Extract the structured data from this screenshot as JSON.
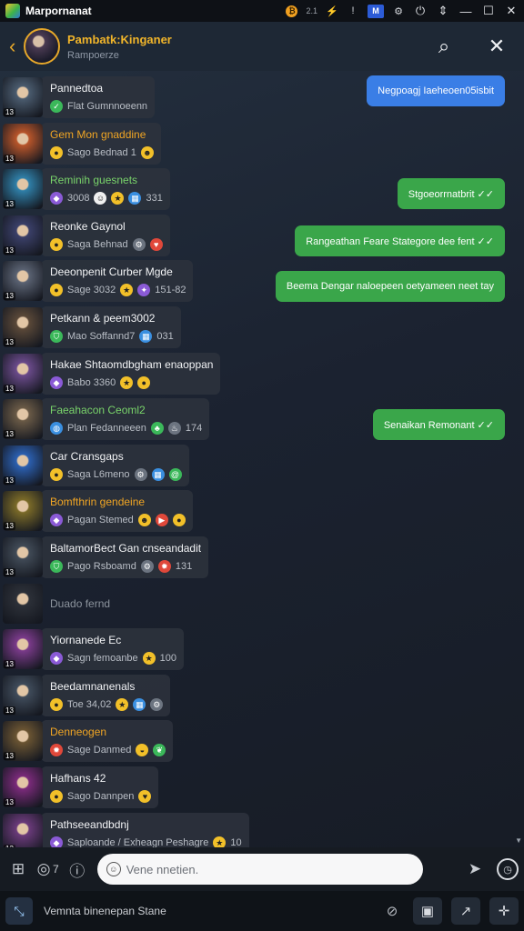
{
  "window": {
    "app_title": "Marpornanat",
    "indicator_small": "2.1",
    "blue_badge": "M",
    "controls": [
      "⓵",
      "⇕",
      "—",
      "☐",
      "✕"
    ]
  },
  "header": {
    "title": "Pambatk:Kinganer",
    "subtitle": "Rampoerze"
  },
  "members": [
    {
      "name": "Pannedtoa",
      "name_color": "white",
      "meta": "Flat Gumnnoeenn",
      "icons": [
        "check"
      ],
      "level": "13",
      "avatar": "#4a5b6e"
    },
    {
      "name": "Gem Mon gnaddine",
      "name_color": "orange",
      "meta": "Sago Bednad 1",
      "icons": [
        "coin",
        "smile"
      ],
      "level": "13",
      "avatar": "#b8552a"
    },
    {
      "name": "Reminih guesnets",
      "name_color": "green",
      "meta": "3008",
      "icons": [
        "gem",
        "face",
        "star",
        "box"
      ],
      "extra": "331",
      "level": "13",
      "avatar": "#2f7fa8"
    },
    {
      "name": "Reonke Gaynol",
      "name_color": "white",
      "meta": "Saga Behnad",
      "icons": [
        "coin",
        "gear",
        "hearts"
      ],
      "level": "13",
      "avatar": "#3a3f68"
    },
    {
      "name": "Deeonpenit Curber Mgde",
      "name_color": "white",
      "meta": "Sage 3032",
      "icons": [
        "coin",
        "star",
        "spark"
      ],
      "extra": "151-82",
      "level": "13",
      "avatar": "#5a6272"
    },
    {
      "name": "Petkann & peem3002",
      "name_color": "white",
      "meta": "Mao Soffannd7",
      "icons": [
        "shield",
        "box"
      ],
      "extra": "031",
      "level": "13",
      "avatar": "#5a4838"
    },
    {
      "name": "Hakae Shtaomdbgham enaoppan",
      "name_color": "white",
      "meta": "Babo 3360",
      "icons": [
        "gem",
        "star",
        "coin"
      ],
      "level": "13",
      "avatar": "#6a4a8a"
    },
    {
      "name": "Faeahacon Ceoml2",
      "name_color": "green",
      "meta": "Plan Fedanneeen",
      "icons": [
        "globe",
        "tree",
        "flame"
      ],
      "extra": "174",
      "level": "13",
      "avatar": "#6a5a46"
    },
    {
      "name": "Car Cransgaps",
      "name_color": "white",
      "meta": "Saga L6meno",
      "icons": [
        "coin",
        "gear",
        "box",
        "swirl"
      ],
      "level": "13",
      "avatar": "#2b5fb0"
    },
    {
      "name": "Bomfthrin gendeine",
      "name_color": "orange",
      "meta": "Pagan Stemed",
      "icons": [
        "gem",
        "smile",
        "play",
        "coin"
      ],
      "level": "13",
      "avatar": "#7a6a28"
    },
    {
      "name": "BaltamorBect Gan cnseandadit",
      "name_color": "white",
      "meta": "Pago Rsboamd",
      "icons": [
        "shield",
        "gear",
        "fire"
      ],
      "extra": "131",
      "level": "13",
      "avatar": "#404a56"
    },
    {
      "name": "Duado fernd",
      "name_color": "gray",
      "meta": "",
      "icons": [],
      "level": "",
      "avatar": "#2c3038"
    },
    {
      "name": "Yiornanede Ec",
      "name_color": "white",
      "meta": "Sagn femoanbe",
      "icons": [
        "gem",
        "star"
      ],
      "extra": "100",
      "level": "13",
      "avatar": "#7a3a8a"
    },
    {
      "name": "Beedamnanenals",
      "name_color": "white",
      "meta": "Toe 34,02",
      "icons": [
        "coin",
        "star",
        "box",
        "gear"
      ],
      "level": "13",
      "avatar": "#3f4b5a"
    },
    {
      "name": "Denneogen",
      "name_color": "orange",
      "meta": "Sage Danmed",
      "icons": [
        "fire",
        "pot",
        "leaf"
      ],
      "level": "13",
      "avatar": "#6a5432"
    },
    {
      "name": "Hafhans 42",
      "name_color": "white",
      "meta": "Sago Dannpen",
      "icons": [
        "coin",
        "heart"
      ],
      "level": "13",
      "avatar": "#7a2a7a"
    },
    {
      "name": "Pathseeandbdnj",
      "name_color": "white",
      "meta": "Saploande / Exheagn Peshagre",
      "icons": [
        "gem",
        "star"
      ],
      "extra": "10",
      "level": "13",
      "avatar": "#6a3a7a"
    }
  ],
  "outgoing": [
    {
      "text": "Negpoagj Iaeheoen05isbit",
      "color": "blue"
    },
    {
      "text": "Stgoeorrnatbrit ✓✓",
      "color": "green"
    },
    {
      "text": "Rangeathan Feare Stategore dee fent ✓✓",
      "color": "green"
    },
    {
      "text": "Beema Dengar naloepeen oetyameen neet tay",
      "color": "green"
    },
    {
      "text": "Senaikan Remonant ✓✓",
      "color": "green"
    }
  ],
  "input": {
    "placeholder": "Vene nnetien.",
    "attach_count": "7"
  },
  "bottom": {
    "status": "Vemnta binenepan Stane"
  }
}
